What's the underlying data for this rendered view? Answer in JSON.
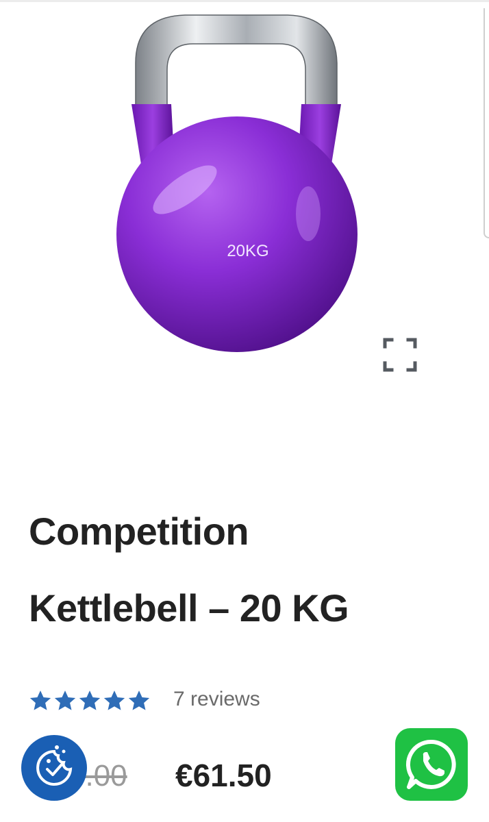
{
  "product": {
    "title_line1": "Competition",
    "title_line2": "Kettlebell – 20 KG",
    "image_weight_label": "20KG",
    "kettlebell_color": "#7a1fc4",
    "handle_color": "#b8bcc0"
  },
  "rating": {
    "stars": 5,
    "star_color": "#2f6db7",
    "reviews_label": "7 reviews"
  },
  "pricing": {
    "old_price": "0.00",
    "price": "€61.50"
  },
  "icons": {
    "zoom": "expand-icon",
    "cookie": "cookie-icon",
    "whatsapp": "whatsapp-icon"
  },
  "colors": {
    "whatsapp_green": "#1fc144",
    "cookie_blue": "#1a5fb4",
    "text_dark": "#222222"
  }
}
